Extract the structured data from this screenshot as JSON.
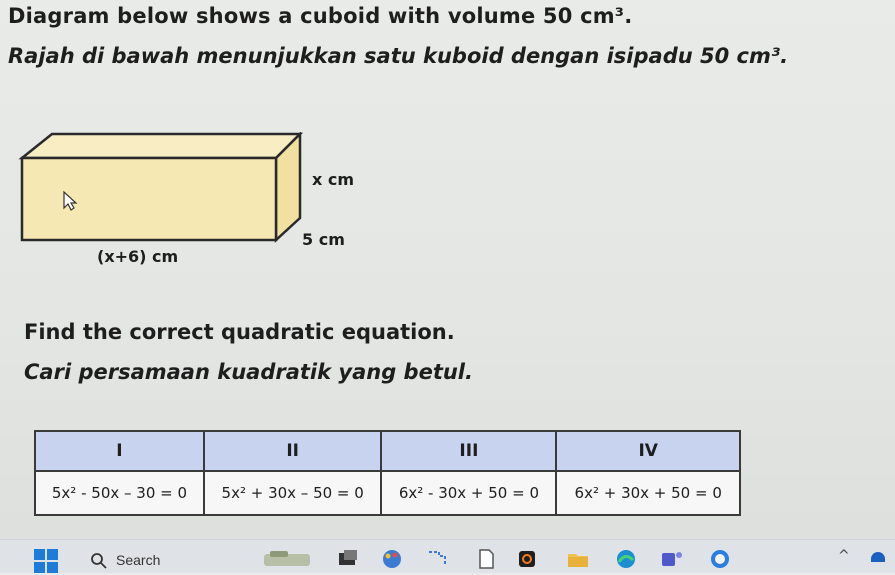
{
  "question": {
    "title_en": "Diagram below shows a cuboid with volume 50 cm³.",
    "title_ms": "Rajah di bawah menunjukkan satu kuboid dengan isipadu 50 cm³.",
    "prompt_en": "Find the correct quadratic equation.",
    "prompt_ms": "Cari persamaan kuadratik yang betul."
  },
  "cuboid": {
    "height_label": "x cm",
    "width_label": "5 cm",
    "length_label": "(x+6) cm",
    "front_color": "#f6e8b2",
    "top_color": "#f8edc3",
    "side_color": "#f1e0a0"
  },
  "options": {
    "headers": [
      "I",
      "II",
      "III",
      "IV"
    ],
    "values": [
      "5x² - 50x – 30 = 0",
      "5x² + 30x – 50 = 0",
      "6x² - 30x + 50 = 0",
      "6x² + 30x + 50 = 0"
    ],
    "header_color": "#c8d3ef"
  },
  "taskbar": {
    "search_label": "Search",
    "icons": [
      "start-icon",
      "search-icon",
      "weather-icon",
      "task-view-icon",
      "paint-icon",
      "snipping-icon",
      "file-icon",
      "office-icon",
      "folder-icon",
      "edge-icon",
      "teams-icon",
      "copilot-icon",
      "chevron-up-icon",
      "network-icon"
    ]
  }
}
